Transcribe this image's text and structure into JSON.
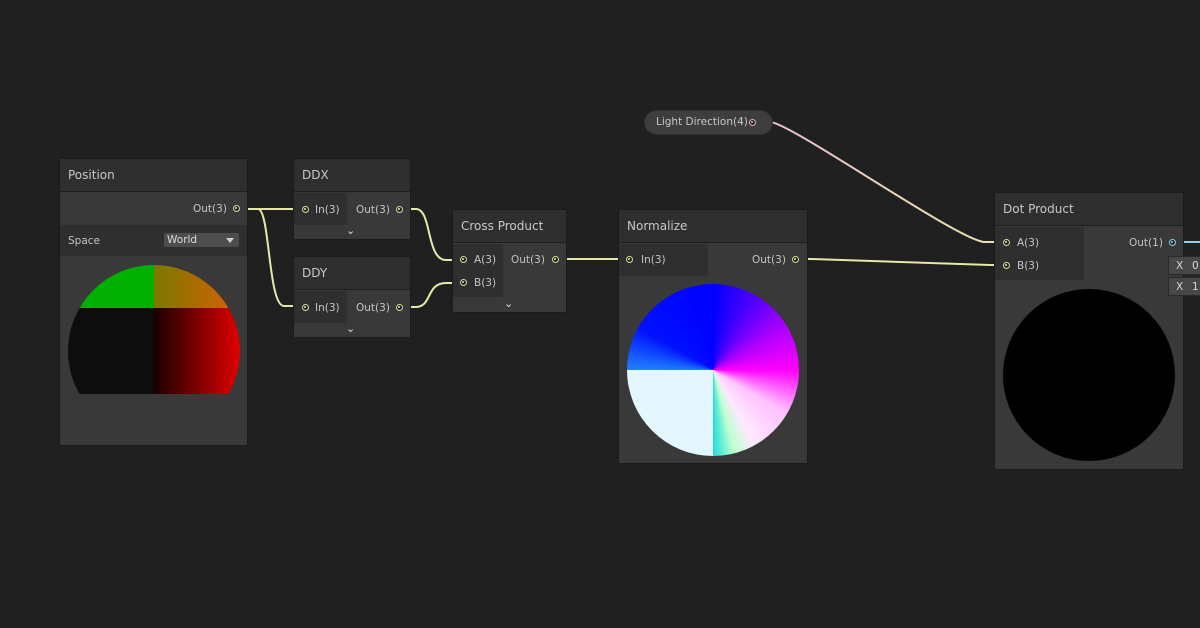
{
  "nodes": {
    "position": {
      "title": "Position",
      "out_label": "Out(3)",
      "space_label": "Space",
      "space_value": "World"
    },
    "ddx": {
      "title": "DDX",
      "in_label": "In(3)",
      "out_label": "Out(3)"
    },
    "ddy": {
      "title": "DDY",
      "in_label": "In(3)",
      "out_label": "Out(3)"
    },
    "cross_product": {
      "title": "Cross Product",
      "a_label": "A(3)",
      "b_label": "B(3)",
      "out_label": "Out(3)"
    },
    "normalize": {
      "title": "Normalize",
      "in_label": "In(3)",
      "out_label": "Out(3)"
    },
    "dot_product": {
      "title": "Dot Product",
      "a_label": "A(3)",
      "b_label": "B(3)",
      "out_label": "Out(1)",
      "fields": [
        {
          "axis": "X",
          "value": "0"
        },
        {
          "axis": "X",
          "value": "1"
        }
      ]
    },
    "light_direction": {
      "label": "Light Direction(4)"
    }
  },
  "colors": {
    "background": "#202020",
    "node_body": "#393939",
    "node_header": "#2f2f2f",
    "wire_vector3": "#e6e8a8",
    "wire_vector4": "#e8b8d0",
    "wire_float": "#8ed1e8"
  },
  "icons": {
    "collapse": "chevron-down-icon",
    "dropdown": "caret-down-icon",
    "port": "port-dot-icon"
  }
}
